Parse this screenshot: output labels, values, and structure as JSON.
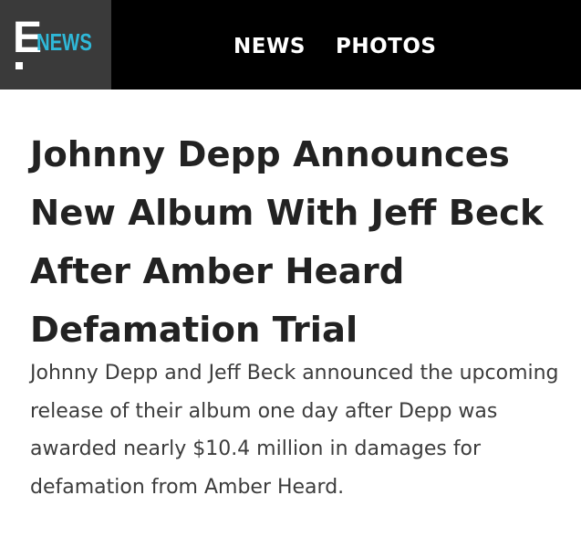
{
  "header": {
    "logo": {
      "letter": "E",
      "word": "NEWS",
      "accent_color": "#2fb8d8"
    },
    "nav": [
      {
        "label": "NEWS"
      },
      {
        "label": "PHOTOS"
      }
    ]
  },
  "article": {
    "headline": "Johnny Depp Announces New Album With Jeff Beck After Amber Heard Defamation Trial",
    "dek": "Johnny Depp and Jeff Beck announced the upcoming release of their album one day after Depp was awarded nearly $10.4 million in damages for defamation from Amber Heard."
  }
}
